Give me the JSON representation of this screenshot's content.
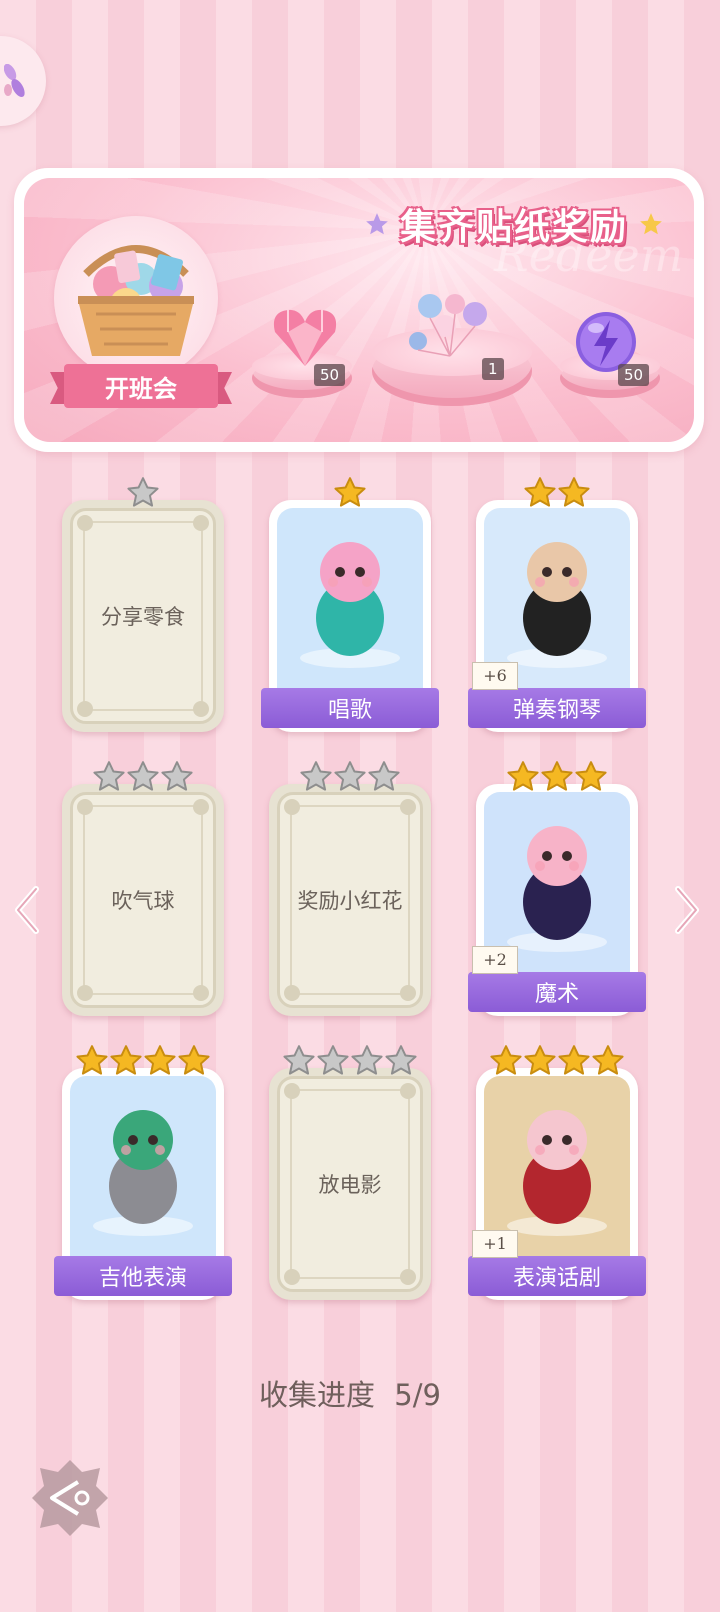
{
  "banner": {
    "title": "集齐贴纸奖励",
    "watermark": "Redeem",
    "basket_label": "开班会",
    "rewards": [
      {
        "icon": "pink-heart-gem-icon",
        "count": "50"
      },
      {
        "icon": "balloon-bunch-icon",
        "count": "1"
      },
      {
        "icon": "purple-lightning-orb-icon",
        "count": "50"
      }
    ]
  },
  "cards": [
    {
      "label": "分享零食",
      "stars": 1,
      "unlocked": false
    },
    {
      "label": "唱歌",
      "stars": 1,
      "unlocked": true,
      "art": "peacock-singing-illustration"
    },
    {
      "label": "弹奏钢琴",
      "stars": 2,
      "unlocked": true,
      "art": "boy-playing-piano-illustration",
      "bonus": "+6"
    },
    {
      "label": "吹气球",
      "stars": 3,
      "unlocked": false
    },
    {
      "label": "奖励小红花",
      "stars": 3,
      "unlocked": false
    },
    {
      "label": "魔术",
      "stars": 3,
      "unlocked": true,
      "art": "magician-girl-illustration",
      "bonus": "+2"
    },
    {
      "label": "吉他表演",
      "stars": 4,
      "unlocked": true,
      "art": "wolf-guitar-illustration"
    },
    {
      "label": "放电影",
      "stars": 4,
      "unlocked": false
    },
    {
      "label": "表演话剧",
      "stars": 4,
      "unlocked": true,
      "art": "cat-girl-red-hood-illustration",
      "bonus": "+1"
    }
  ],
  "progress": {
    "label": "收集进度",
    "value": "5/9"
  },
  "colors": {
    "gold_star": "#f5b822",
    "grey_star": "#c8c8c8",
    "name_bar": "#9566dd",
    "accent_pink": "#ee7196"
  }
}
